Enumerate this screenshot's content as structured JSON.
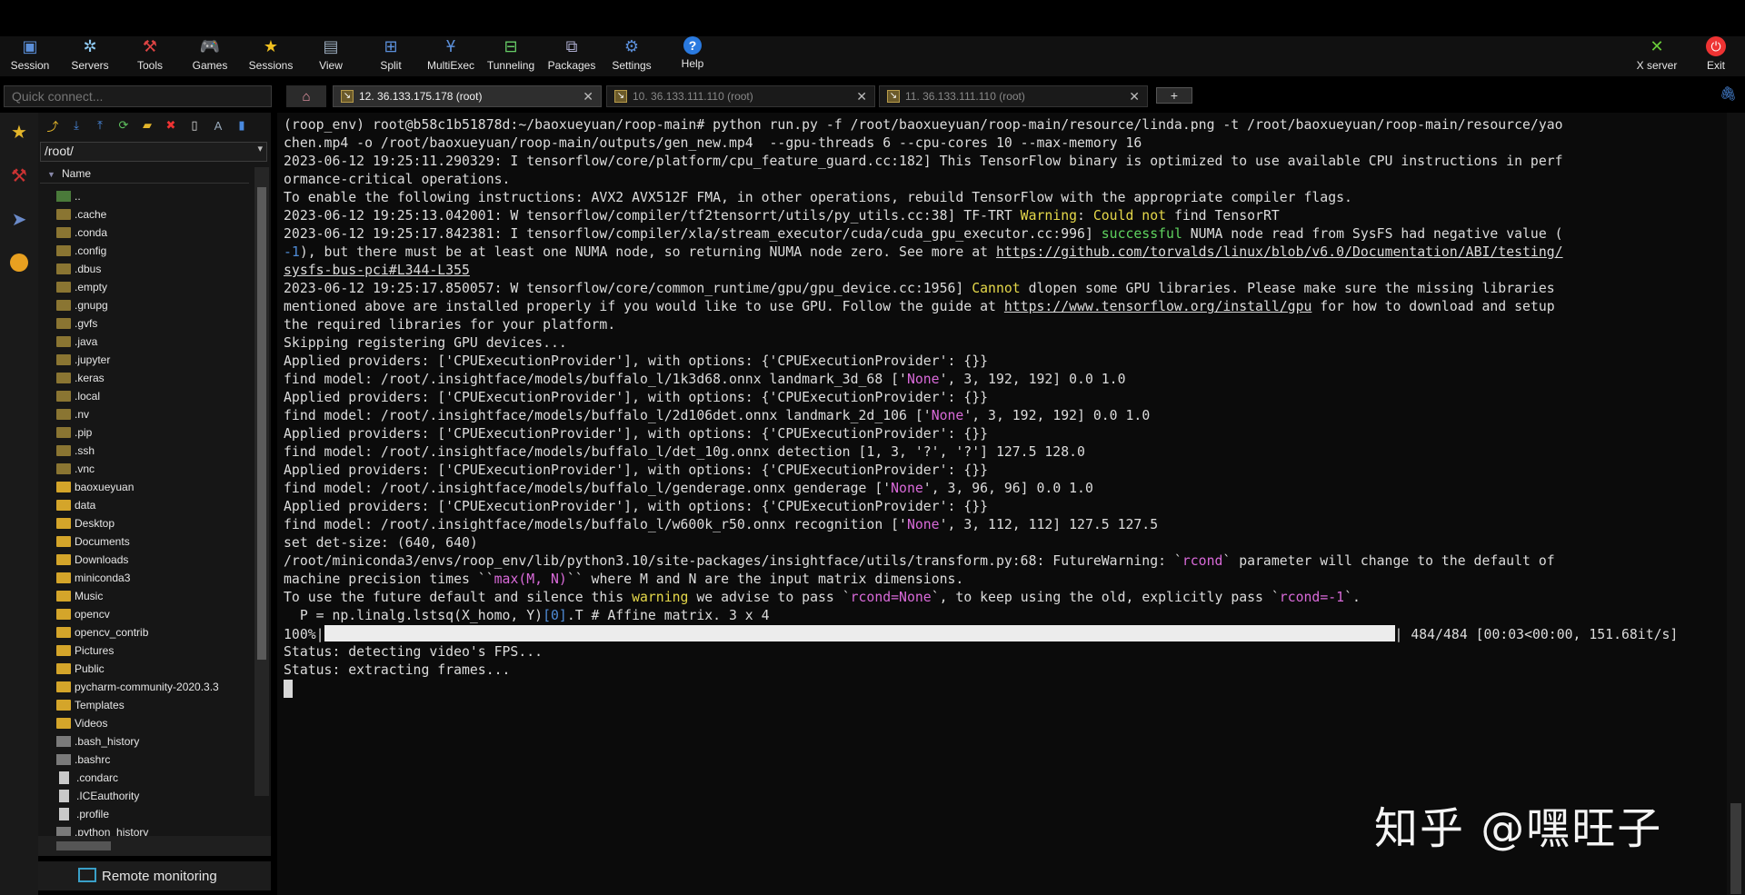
{
  "toolbar": {
    "buttons": [
      {
        "label": "Session",
        "icon": "session-icon"
      },
      {
        "label": "Servers",
        "icon": "servers-icon"
      },
      {
        "label": "Tools",
        "icon": "tools-icon"
      },
      {
        "label": "Games",
        "icon": "games-icon"
      },
      {
        "label": "Sessions",
        "icon": "star-icon"
      },
      {
        "label": "View",
        "icon": "view-icon"
      },
      {
        "label": "Split",
        "icon": "split-icon"
      },
      {
        "label": "MultiExec",
        "icon": "multiexec-icon"
      },
      {
        "label": "Tunneling",
        "icon": "tunneling-icon"
      },
      {
        "label": "Packages",
        "icon": "packages-icon"
      },
      {
        "label": "Settings",
        "icon": "gear-icon"
      },
      {
        "label": "Help",
        "icon": "help-icon"
      }
    ],
    "xserver_label": "X server",
    "exit_label": "Exit"
  },
  "quick_connect": {
    "placeholder": "Quick connect..."
  },
  "tabs": [
    {
      "label": "12. 36.133.175.178 (root)",
      "active": true
    },
    {
      "label": "10. 36.133.111.110 (root)",
      "active": false
    },
    {
      "label": "11. 36.133.111.110 (root)",
      "active": false
    }
  ],
  "sidebar": {
    "path": "/root/",
    "column_header": "Name",
    "files": [
      {
        "name": "..",
        "type": "up"
      },
      {
        "name": ".cache",
        "type": "hidden-folder"
      },
      {
        "name": ".conda",
        "type": "hidden-folder"
      },
      {
        "name": ".config",
        "type": "hidden-folder"
      },
      {
        "name": ".dbus",
        "type": "hidden-folder"
      },
      {
        "name": ".empty",
        "type": "hidden-folder"
      },
      {
        "name": ".gnupg",
        "type": "hidden-folder"
      },
      {
        "name": ".gvfs",
        "type": "hidden-folder"
      },
      {
        "name": ".java",
        "type": "hidden-folder"
      },
      {
        "name": ".jupyter",
        "type": "hidden-folder"
      },
      {
        "name": ".keras",
        "type": "hidden-folder"
      },
      {
        "name": ".local",
        "type": "hidden-folder"
      },
      {
        "name": ".nv",
        "type": "hidden-folder"
      },
      {
        "name": ".pip",
        "type": "hidden-folder"
      },
      {
        "name": ".ssh",
        "type": "hidden-folder"
      },
      {
        "name": ".vnc",
        "type": "hidden-folder"
      },
      {
        "name": "baoxueyuan",
        "type": "folder"
      },
      {
        "name": "data",
        "type": "folder"
      },
      {
        "name": "Desktop",
        "type": "folder"
      },
      {
        "name": "Documents",
        "type": "folder"
      },
      {
        "name": "Downloads",
        "type": "folder"
      },
      {
        "name": "miniconda3",
        "type": "folder"
      },
      {
        "name": "Music",
        "type": "folder"
      },
      {
        "name": "opencv",
        "type": "folder"
      },
      {
        "name": "opencv_contrib",
        "type": "folder"
      },
      {
        "name": "Pictures",
        "type": "folder"
      },
      {
        "name": "Public",
        "type": "folder"
      },
      {
        "name": "pycharm-community-2020.3.3",
        "type": "folder"
      },
      {
        "name": "Templates",
        "type": "folder"
      },
      {
        "name": "Videos",
        "type": "folder"
      },
      {
        "name": ".bash_history",
        "type": "file-dark"
      },
      {
        "name": ".bashrc",
        "type": "file-dark"
      },
      {
        "name": ".condarc",
        "type": "file"
      },
      {
        "name": ".ICEauthority",
        "type": "file"
      },
      {
        "name": ".profile",
        "type": "file"
      },
      {
        "name": ".python_history",
        "type": "file-dark"
      }
    ],
    "remote_monitoring_label": "Remote monitoring"
  },
  "terminal": {
    "lines": [
      [
        {
          "t": "(roop_env) root@b58c1b51878d:~/baoxueyuan/roop-main# python run.py -f /root/baoxueyuan/roop-main/resource/linda.png -t /root/baoxueyuan/roop-main/resource/yao"
        }
      ],
      [
        {
          "t": "chen.mp4 -o /root/baoxueyuan/roop-main/outputs/gen_new.mp4  --gpu-threads 6 --cpu-cores 10 --max-memory 16"
        }
      ],
      [
        {
          "t": "2023-06-12 19:25:11.290329: I tensorflow/core/platform/cpu_feature_guard.cc:182] This TensorFlow binary is optimized to use available CPU instructions in perf"
        }
      ],
      [
        {
          "t": "ormance-critical operations."
        }
      ],
      [
        {
          "t": "To enable the following instructions: AVX2 AVX512F FMA, in other operations, rebuild TensorFlow with the appropriate compiler flags."
        }
      ],
      [
        {
          "t": "2023-06-12 19:25:13.042001: W tensorflow/compiler/tf2tensorrt/utils/py_utils.cc:38] TF-TRT "
        },
        {
          "t": "Warning",
          "c": "y"
        },
        {
          "t": ": "
        },
        {
          "t": "Could not",
          "c": "y"
        },
        {
          "t": " find TensorRT"
        }
      ],
      [
        {
          "t": "2023-06-12 19:25:17.842381: I tensorflow/compiler/xla/stream_executor/cuda/cuda_gpu_executor.cc:996] "
        },
        {
          "t": "successful",
          "c": "g"
        },
        {
          "t": " NUMA node read from SysFS had negative value ("
        }
      ],
      [
        {
          "t": "-1",
          "c": "b"
        },
        {
          "t": "), but there must be at least one NUMA node, so returning NUMA node zero. See more at "
        },
        {
          "t": "https://github.com/torvalds/linux/blob/v6.0/Documentation/ABI/testing/",
          "c": "u"
        }
      ],
      [
        {
          "t": "sysfs-bus-pci#L344-L355",
          "c": "u"
        }
      ],
      [
        {
          "t": "2023-06-12 19:25:17.850057: W tensorflow/core/common_runtime/gpu/gpu_device.cc:1956] "
        },
        {
          "t": "Cannot",
          "c": "y"
        },
        {
          "t": " dlopen some GPU libraries. Please make sure the missing libraries"
        }
      ],
      [
        {
          "t": "mentioned above are installed properly if you would like to use GPU. Follow the guide at "
        },
        {
          "t": "https://www.tensorflow.org/install/gpu",
          "c": "u"
        },
        {
          "t": " for how to download and setup"
        }
      ],
      [
        {
          "t": "the required libraries for your platform."
        }
      ],
      [
        {
          "t": "Skipping registering GPU devices..."
        }
      ],
      [
        {
          "t": "Applied providers: ['CPUExecutionProvider'], with options: {'CPUExecutionProvider': {}}"
        }
      ],
      [
        {
          "t": "find model: /root/.insightface/models/buffalo_l/1k3d68.onnx landmark_3d_68 ['"
        },
        {
          "t": "None",
          "c": "m"
        },
        {
          "t": "', 3, 192, 192] 0.0 1.0"
        }
      ],
      [
        {
          "t": "Applied providers: ['CPUExecutionProvider'], with options: {'CPUExecutionProvider': {}}"
        }
      ],
      [
        {
          "t": "find model: /root/.insightface/models/buffalo_l/2d106det.onnx landmark_2d_106 ['"
        },
        {
          "t": "None",
          "c": "m"
        },
        {
          "t": "', 3, 192, 192] 0.0 1.0"
        }
      ],
      [
        {
          "t": "Applied providers: ['CPUExecutionProvider'], with options: {'CPUExecutionProvider': {}}"
        }
      ],
      [
        {
          "t": "find model: /root/.insightface/models/buffalo_l/det_10g.onnx detection [1, 3, '?', '?'] 127.5 128.0"
        }
      ],
      [
        {
          "t": "Applied providers: ['CPUExecutionProvider'], with options: {'CPUExecutionProvider': {}}"
        }
      ],
      [
        {
          "t": "find model: /root/.insightface/models/buffalo_l/genderage.onnx genderage ['"
        },
        {
          "t": "None",
          "c": "m"
        },
        {
          "t": "', 3, 96, 96] 0.0 1.0"
        }
      ],
      [
        {
          "t": "Applied providers: ['CPUExecutionProvider'], with options: {'CPUExecutionProvider': {}}"
        }
      ],
      [
        {
          "t": "find model: /root/.insightface/models/buffalo_l/w600k_r50.onnx recognition ['"
        },
        {
          "t": "None",
          "c": "m"
        },
        {
          "t": "', 3, 112, 112] 127.5 127.5"
        }
      ],
      [
        {
          "t": "set det-size: (640, 640)"
        }
      ],
      [
        {
          "t": "/root/miniconda3/envs/roop_env/lib/python3.10/site-packages/insightface/utils/transform.py:68: FutureWarning: `"
        },
        {
          "t": "rcond",
          "c": "m"
        },
        {
          "t": "` parameter will change to the default of"
        }
      ],
      [
        {
          "t": "machine precision times ``"
        },
        {
          "t": "max(M, N)",
          "c": "m"
        },
        {
          "t": "`` where M and N are the input matrix dimensions."
        }
      ],
      [
        {
          "t": "To use the future default and silence this "
        },
        {
          "t": "warning",
          "c": "y"
        },
        {
          "t": " we advise to pass `"
        },
        {
          "t": "rcond=None",
          "c": "m"
        },
        {
          "t": "`, to keep using the old, explicitly pass `"
        },
        {
          "t": "rcond=-1",
          "c": "m"
        },
        {
          "t": "`."
        }
      ],
      [
        {
          "t": "  P = np.linalg.lstsq(X_homo, Y)"
        },
        {
          "t": "[0]",
          "c": "b"
        },
        {
          "t": ".T # Affine matrix. 3 x 4"
        }
      ]
    ],
    "progress": {
      "percent_label": "100%|",
      "fraction": 1.0,
      "tail": "| 484/484 [00:03<00:00, 151.68it/s]"
    },
    "status_lines": [
      "Status: detecting video's FPS...",
      "Status: extracting frames..."
    ]
  },
  "watermark": "知乎 @嘿旺子"
}
